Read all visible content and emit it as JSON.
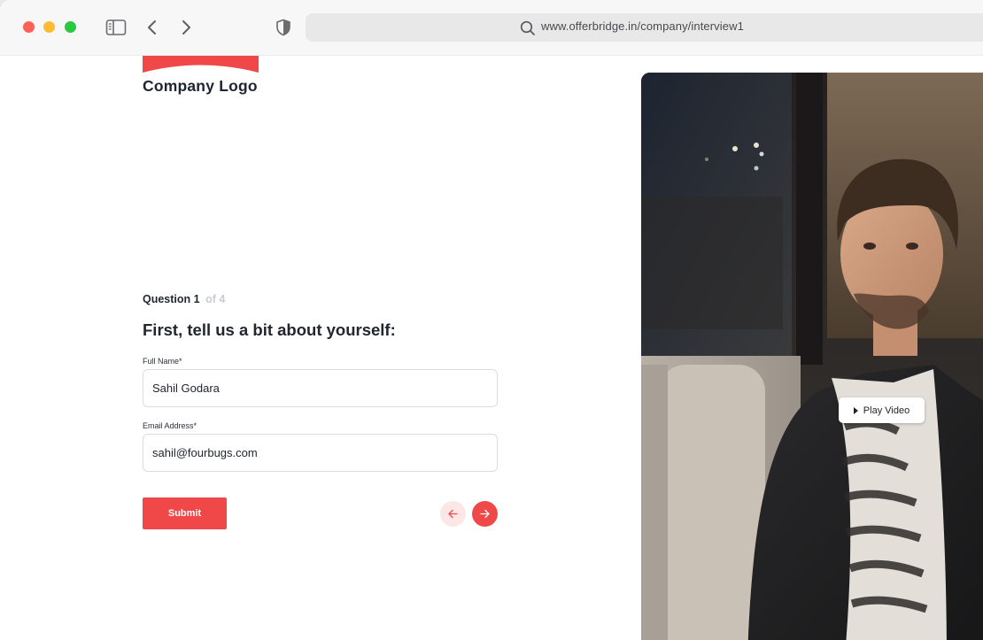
{
  "browser": {
    "url": "www.offerbridge.in/company/interview1",
    "icons": [
      "sidebar-icon",
      "back-icon",
      "forward-icon",
      "shield-icon",
      "search-icon"
    ]
  },
  "logo": {
    "text": "Company Logo",
    "accent": "#f04848"
  },
  "question": {
    "current_label": "Question 1",
    "of_label": "of 4",
    "title": "First, tell us a bit about yourself:"
  },
  "form": {
    "full_name_label": "Full Name*",
    "full_name_value": "Sahil Godara",
    "email_label": "Email Address*",
    "email_value": "sahil@fourbugs.com",
    "submit_label": "Submit"
  },
  "video": {
    "play_label": "Play Video"
  },
  "colors": {
    "accent": "#f04848",
    "accent_light": "#fde6e6"
  }
}
